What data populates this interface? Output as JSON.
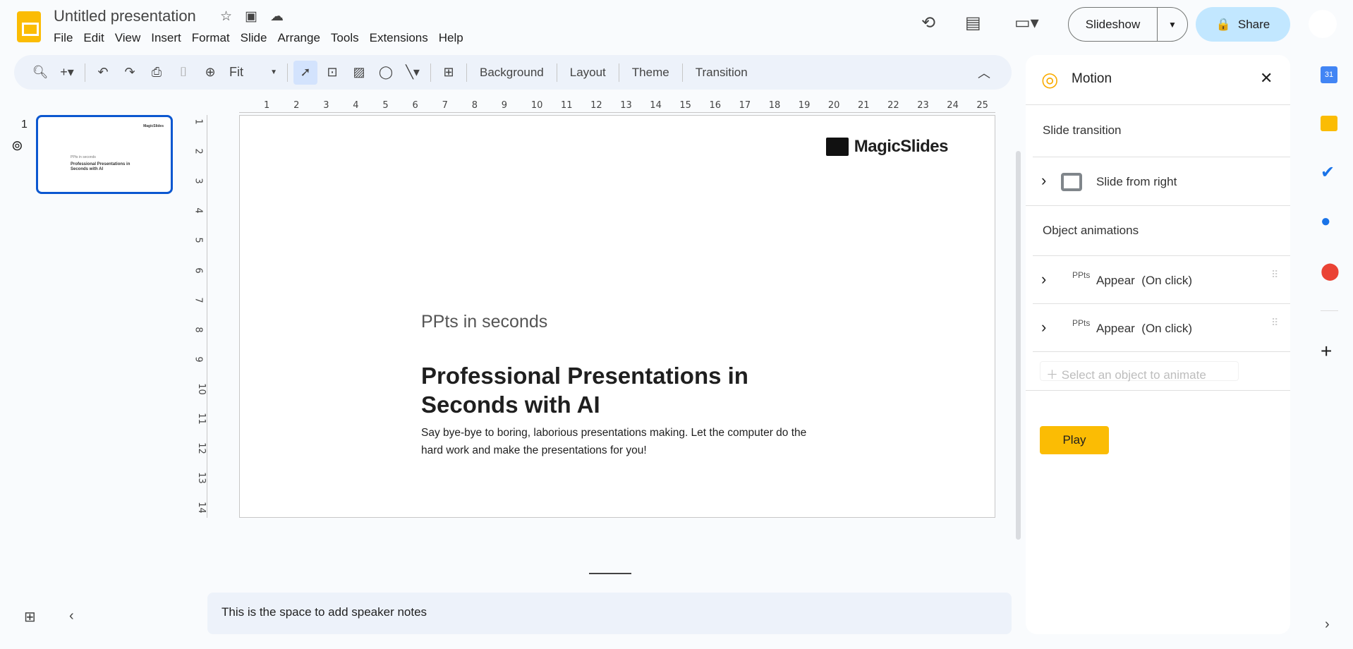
{
  "app": {
    "title": "Untitled presentation"
  },
  "menu": [
    "File",
    "Edit",
    "View",
    "Insert",
    "Format",
    "Slide",
    "Arrange",
    "Tools",
    "Extensions",
    "Help"
  ],
  "toolbar": {
    "zoom_value": "Fit",
    "background": "Background",
    "layout": "Layout",
    "theme": "Theme",
    "transition": "Transition"
  },
  "header": {
    "slideshow": "Slideshow",
    "share": "Share"
  },
  "filmstrip": {
    "slide_number": "1"
  },
  "ruler": {
    "top": [
      "1",
      "2",
      "3",
      "4",
      "5",
      "6",
      "7",
      "8",
      "9",
      "10",
      "11",
      "12",
      "13",
      "14",
      "15",
      "16",
      "17",
      "18",
      "19",
      "20",
      "21",
      "22",
      "23",
      "24",
      "25"
    ],
    "left": [
      "1",
      "2",
      "3",
      "4",
      "5",
      "6",
      "7",
      "8",
      "9",
      "10",
      "11",
      "12",
      "13",
      "14"
    ]
  },
  "slide": {
    "logo_text": "MagicSlides",
    "subtitle": "PPts in seconds",
    "title_line1": "Professional Presentations in",
    "title_line2": "Seconds with AI",
    "body_line1": "Say bye-bye to boring, laborious presentations making. Let the computer do the",
    "body_line2": "hard work and make the presentations for you!"
  },
  "notes": {
    "text": "This is the space to add speaker notes"
  },
  "motion": {
    "title": "Motion",
    "slide_transition_heading": "Slide transition",
    "transition": "Slide from right",
    "object_animations_heading": "Object animations",
    "animations": [
      {
        "object": "PPts",
        "effect": "Appear",
        "trigger": "(On click)"
      },
      {
        "object": "PPts",
        "effect": "Appear",
        "trigger": "(On click)"
      }
    ],
    "select_prompt": "Select an object to animate",
    "play": "Play"
  },
  "colors": {
    "accent": "#0b57d0",
    "play": "#fbbc04",
    "share_bg": "#c2e7ff"
  }
}
